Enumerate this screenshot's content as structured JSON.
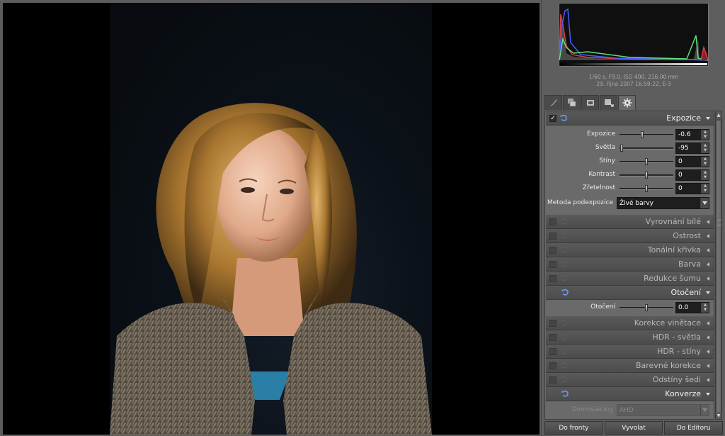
{
  "histogram": {
    "exif_line1": "1/60 s, F9.0, ISO 400, 216.00 mm",
    "exif_line2": "29. října 2007 16:59:22, E-3"
  },
  "tabs": [
    {
      "icon": "brush-icon"
    },
    {
      "icon": "layers-icon"
    },
    {
      "icon": "crop-icon"
    },
    {
      "icon": "export-icon"
    },
    {
      "icon": "settings-gear-icon",
      "active": true
    }
  ],
  "sections": {
    "exposure": {
      "title": "Expozice",
      "enabled": true,
      "check_glyph": "✓",
      "sliders": [
        {
          "label": "Expozice",
          "value": "-0.6",
          "position": 0.42
        },
        {
          "label": "Světla",
          "value": "-95",
          "position": 0.02
        },
        {
          "label": "Stíny",
          "value": "0",
          "position": 0.5
        },
        {
          "label": "Kontrast",
          "value": "0",
          "position": 0.5
        },
        {
          "label": "Zřetelnost",
          "value": "0",
          "position": 0.5
        }
      ],
      "method_label": "Metoda podexpozice",
      "method_value": "Živé barvy"
    },
    "white_balance": {
      "title": "Vyrovnání bílé"
    },
    "sharpness": {
      "title": "Ostrost"
    },
    "tone_curve": {
      "title": "Tonální křivka"
    },
    "color": {
      "title": "Barva"
    },
    "noise": {
      "title": "Redukce šumu"
    },
    "rotation": {
      "title": "Otočení",
      "slider": {
        "label": "Otočení",
        "value": "0.0",
        "position": 0.5
      }
    },
    "vignette": {
      "title": "Korekce vinětace"
    },
    "hdr_highlights": {
      "title": "HDR - světla"
    },
    "hdr_shadows": {
      "title": "HDR - stíny"
    },
    "color_corrections": {
      "title": "Barevné korekce"
    },
    "grayscale": {
      "title": "Odstíny šedi"
    },
    "conversion": {
      "title": "Konverze",
      "demosaicing_label": "Demosaicing",
      "demosaicing_value": "AHD"
    }
  },
  "buttons": {
    "queue": "Do fronty",
    "develop": "Vyvolat",
    "editor": "Do Editoru"
  },
  "colors": {
    "panel_bg": "#6a6a6a",
    "header_bg": "#4d4d4d",
    "field_bg": "#1e1e1e"
  }
}
